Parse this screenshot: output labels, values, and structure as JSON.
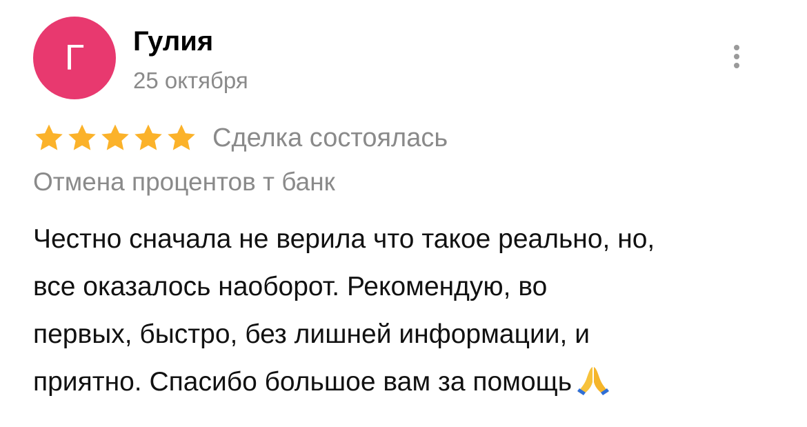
{
  "review": {
    "author": {
      "avatar_letter": "Г",
      "avatar_color": "#e8396f",
      "name": "Гулия"
    },
    "date": "25 октября",
    "menu_icon": "more-vertical-icon",
    "rating": {
      "stars": 5,
      "max_stars": 5,
      "star_color": "#fbb22a",
      "star_icon": "star-icon"
    },
    "deal_status": "Сделка состоялась",
    "subject": "Отмена процентов т банк",
    "text_lines": [
      "Честно сначала не верила что такое реально, но,",
      "все оказалось наоборот. Рекомендую, во",
      "первых, быстро, без лишней информации, и",
      "приятно. Спасибо большое вам за помощь"
    ],
    "trailing_emoji": "folded-hands-icon"
  }
}
